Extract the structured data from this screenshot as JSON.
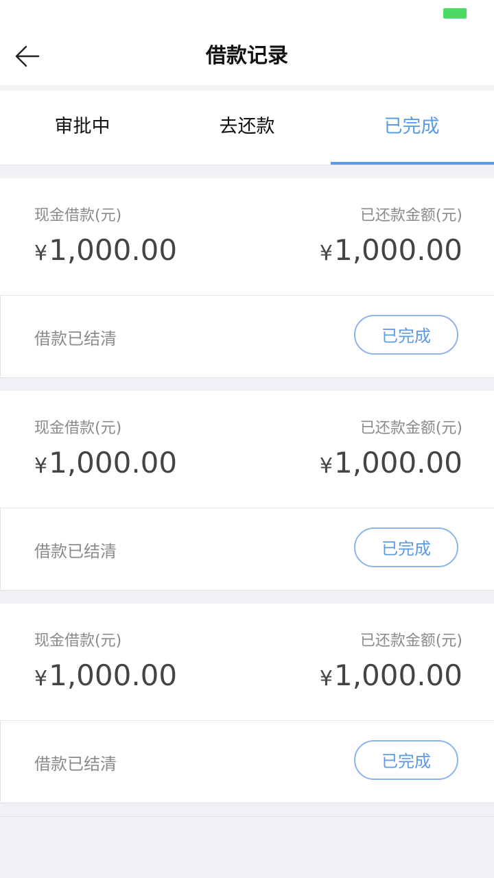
{
  "header": {
    "title": "借款记录"
  },
  "tabs": [
    {
      "label": "审批中"
    },
    {
      "label": "去还款"
    },
    {
      "label": "已完成",
      "active": true
    }
  ],
  "colors": {
    "accent": "#5b9ae6",
    "battery": "#4cd964"
  },
  "records": [
    {
      "loan_label": "现金借款(元)",
      "repaid_label": "已还款金额(元)",
      "currency": "¥",
      "loan_amount": "1,000.00",
      "repaid_amount": "1,000.00",
      "status": "借款已结清",
      "action_label": "已完成"
    },
    {
      "loan_label": "现金借款(元)",
      "repaid_label": "已还款金额(元)",
      "currency": "¥",
      "loan_amount": "1,000.00",
      "repaid_amount": "1,000.00",
      "status": "借款已结清",
      "action_label": "已完成"
    },
    {
      "loan_label": "现金借款(元)",
      "repaid_label": "已还款金额(元)",
      "currency": "¥",
      "loan_amount": "1,000.00",
      "repaid_amount": "1,000.00",
      "status": "借款已结清",
      "action_label": "已完成"
    }
  ]
}
